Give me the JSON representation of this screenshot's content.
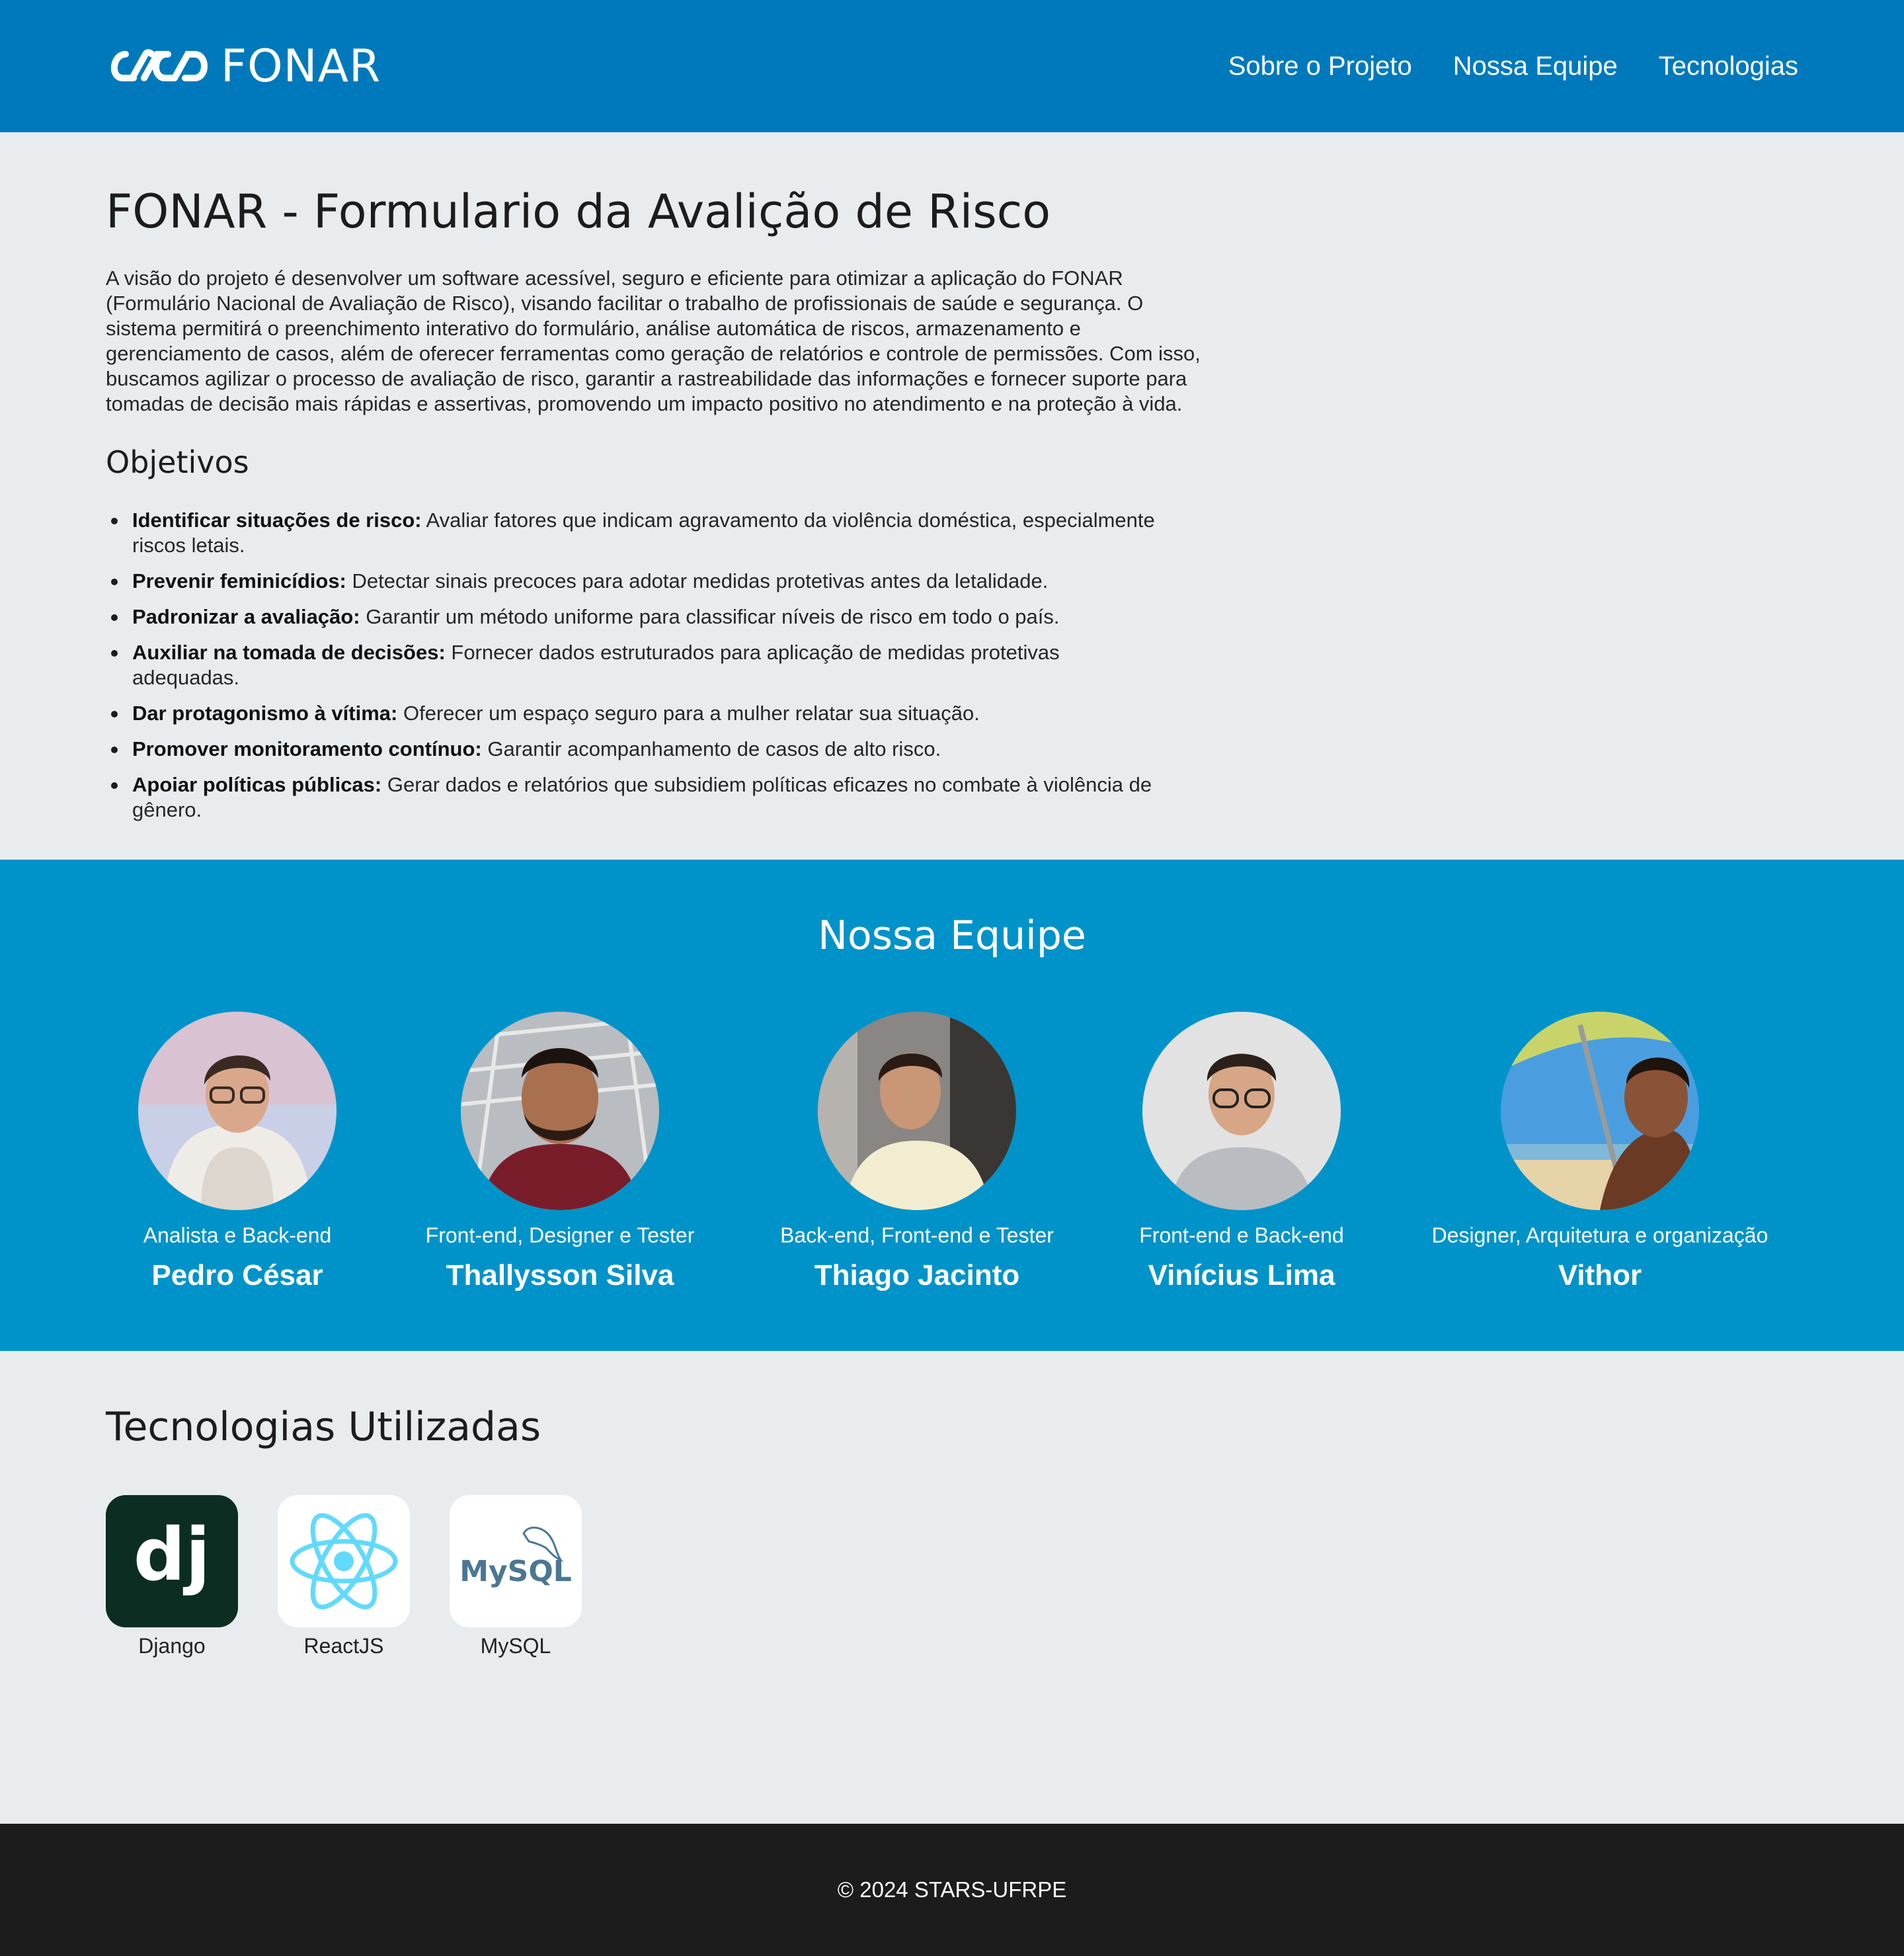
{
  "brand": {
    "name": "FONAR"
  },
  "nav": [
    {
      "label": "Sobre o Projeto"
    },
    {
      "label": "Nossa Equipe"
    },
    {
      "label": "Tecnologias"
    }
  ],
  "about": {
    "title": "FONAR - Formulario da Avalição de Risco",
    "vision": "A visão do projeto é desenvolver um software acessível, seguro e eficiente para otimizar a aplicação do FONAR (Formulário Nacional de Avaliação de Risco), visando facilitar o trabalho de profissionais de saúde e segurança. O sistema permitirá o preenchimento interativo do formulário, análise automática de riscos, armazenamento e gerenciamento de casos, além de oferecer ferramentas como geração de relatórios e controle de permissões. Com isso, buscamos agilizar o processo de avaliação de risco, garantir a rastreabilidade das informações e fornecer suporte para tomadas de decisão mais rápidas e assertivas, promovendo um impacto positivo no atendimento e na proteção à vida.",
    "objectives_title": "Objetivos",
    "objectives": [
      {
        "label": "Identificar situações de risco:",
        "text": " Avaliar fatores que indicam agravamento da violência doméstica, especialmente riscos letais."
      },
      {
        "label": "Prevenir feminicídios:",
        "text": " Detectar sinais precoces para adotar medidas protetivas antes da letalidade."
      },
      {
        "label": "Padronizar a avaliação:",
        "text": " Garantir um método uniforme para classificar níveis de risco em todo o país."
      },
      {
        "label": "Auxiliar na tomada de decisões:",
        "text": " Fornecer dados estruturados para aplicação de medidas protetivas adequadas."
      },
      {
        "label": "Dar protagonismo à vítima:",
        "text": " Oferecer um espaço seguro para a mulher relatar sua situação."
      },
      {
        "label": "Promover monitoramento contínuo:",
        "text": " Garantir acompanhamento de casos de alto risco."
      },
      {
        "label": "Apoiar políticas públicas:",
        "text": " Gerar dados e relatórios que subsidiem políticas eficazes no combate à violência de gênero."
      }
    ]
  },
  "team": {
    "title": "Nossa Equipe",
    "members": [
      {
        "role": "Analista e Back-end",
        "name": "Pedro César"
      },
      {
        "role": "Front-end, Designer e Tester",
        "name": "Thallysson Silva"
      },
      {
        "role": "Back-end, Front-end e Tester",
        "name": "Thiago Jacinto"
      },
      {
        "role": "Front-end e Back-end",
        "name": "Vinícius Lima"
      },
      {
        "role": "Designer, Arquitetura e organização",
        "name": "Vithor"
      }
    ]
  },
  "tech": {
    "title": "Tecnologias Utilizadas",
    "items": [
      {
        "label": "Django",
        "logo_text": "dj",
        "icon": "django-logo-icon"
      },
      {
        "label": "ReactJS",
        "icon": "react-logo-icon"
      },
      {
        "label": "MySQL",
        "logo_text": "MySQL",
        "icon": "mysql-logo-icon"
      }
    ]
  },
  "footer": {
    "text": "© 2024 STARS-UFRPE"
  },
  "colors": {
    "header": "#0079bc",
    "team_bg": "#0093c9",
    "page_bg": "#e8ecef",
    "footer_bg": "#1c1c1c"
  }
}
